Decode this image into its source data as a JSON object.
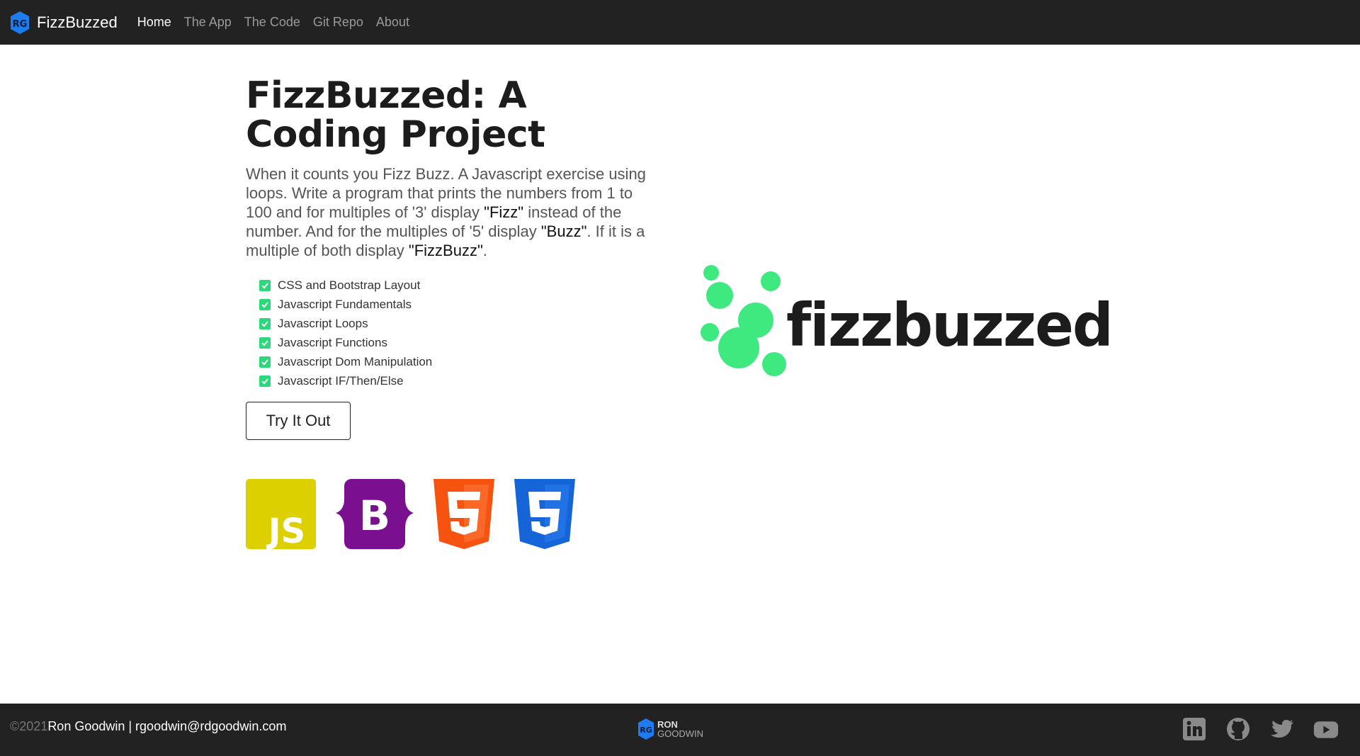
{
  "navbar": {
    "brand": "FizzBuzzed",
    "links": [
      "Home",
      "The App",
      "The Code",
      "Git Repo",
      "About"
    ]
  },
  "hero": {
    "title": "FizzBuzzed: A Coding Project",
    "lead": {
      "p1": "When it counts you Fizz Buzz. A Javascript exercise using loops. Write a program that prints the numbers from 1 to 100 and for multiples of '3' display ",
      "fizz": "\"Fizz\"",
      "p2": " instead of the number. And for the multiples of '5' display ",
      "buzz": "\"Buzz\"",
      "p3": ". If it is a multiple of both display ",
      "fizzbuzz": "\"FizzBuzz\"",
      "p4": "."
    },
    "features": [
      "CSS and Bootstrap Layout",
      "Javascript Fundamentals",
      "Javascript Loops",
      "Javascript Functions",
      "Javascript Dom Manipulation",
      "Javascript IF/Then/Else"
    ],
    "button": "Try It Out",
    "tech_icons": [
      "javascript-icon",
      "bootstrap-icon",
      "html5-icon",
      "css3-icon"
    ],
    "logo_text": "fizzbuzzed"
  },
  "footer": {
    "copyright": "©2021",
    "owner": "Ron Goodwin | rgoodwin@rdgoodwin.com",
    "center_logo_top": "RON",
    "center_logo_bottom": "GOODWIN",
    "social_icons": [
      "linkedin-icon",
      "github-icon",
      "twitter-icon",
      "youtube-icon"
    ]
  },
  "colors": {
    "nav_bg": "#222223",
    "accent_green": "#3ee97f",
    "js_yellow": "#dcd000",
    "bootstrap_purple": "#7a0f90",
    "html_orange": "#f5530f",
    "css_blue": "#1565d8",
    "brand_blue": "#1e7bf0"
  }
}
